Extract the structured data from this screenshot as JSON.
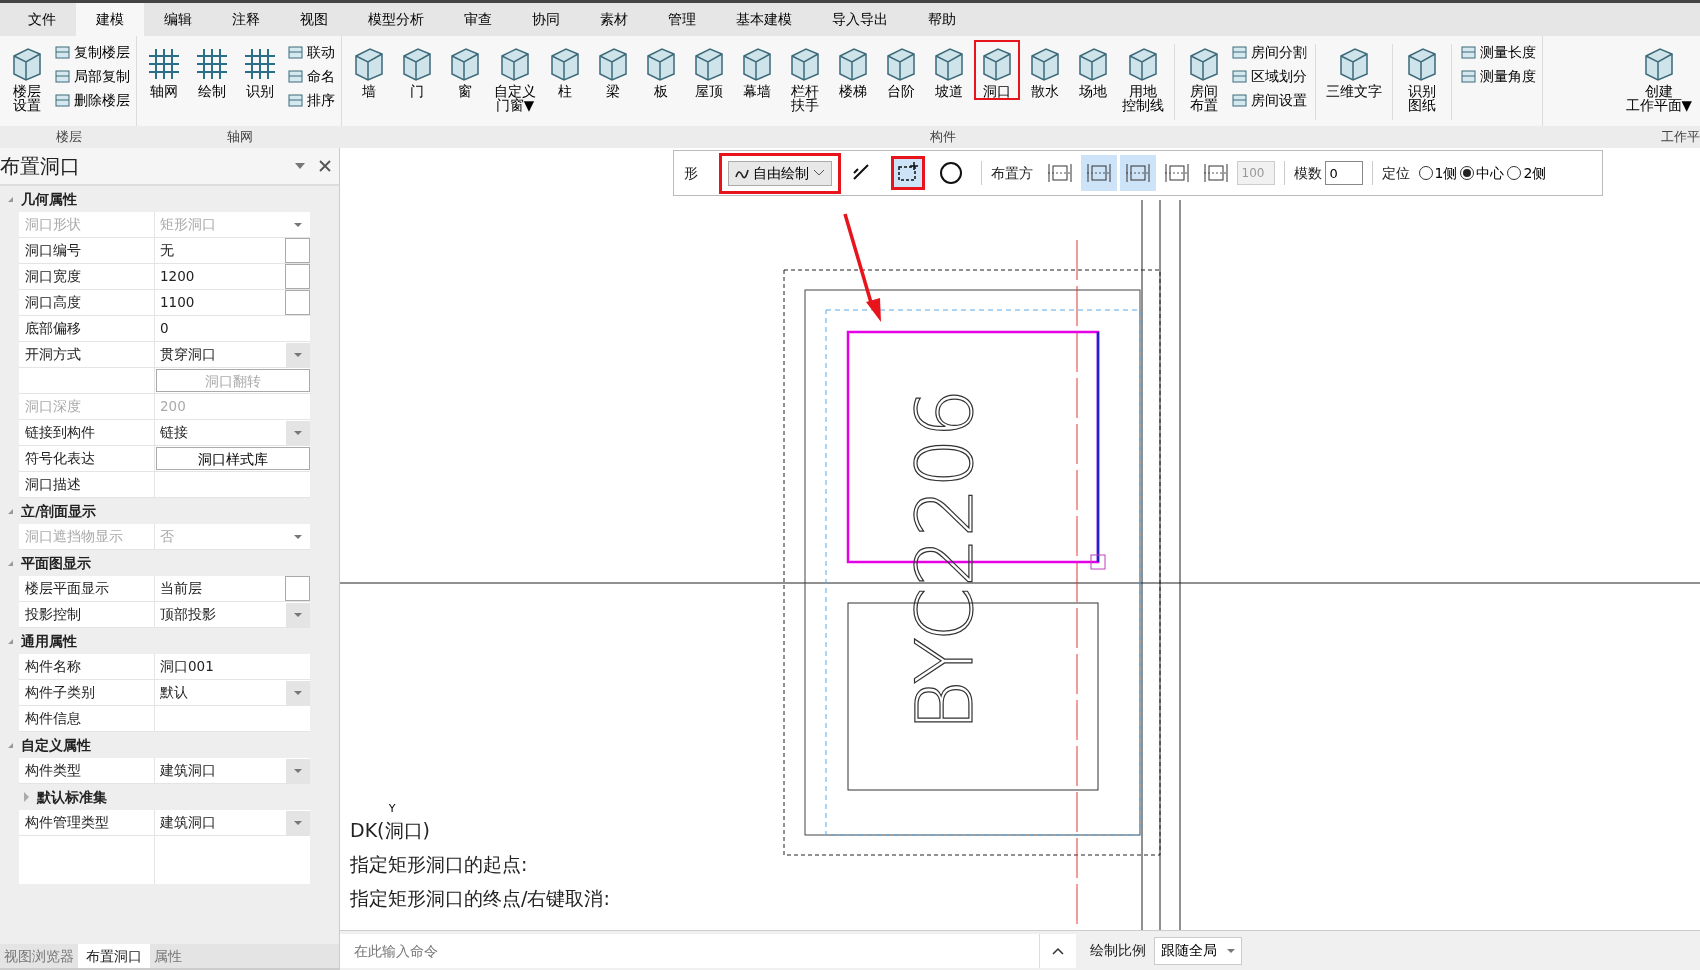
{
  "menu_tabs": [
    {
      "label": "文件",
      "selected": false
    },
    {
      "label": "建模",
      "selected": true
    },
    {
      "label": "编辑",
      "selected": false
    },
    {
      "label": "注释",
      "selected": false
    },
    {
      "label": "视图",
      "selected": false
    },
    {
      "label": "模型分析",
      "selected": false
    },
    {
      "label": "审查",
      "selected": false
    },
    {
      "label": "协同",
      "selected": false
    },
    {
      "label": "素材",
      "selected": false
    },
    {
      "label": "管理",
      "selected": false
    },
    {
      "label": "基本建模",
      "selected": false
    },
    {
      "label": "导入导出",
      "selected": false
    },
    {
      "label": "帮助",
      "selected": false
    }
  ],
  "ribbon": [
    {
      "label": "楼层",
      "items": [
        {
          "kind": "large",
          "lines": [
            "楼层",
            "设置"
          ],
          "highlighted": false
        },
        {
          "kind": "stack",
          "items": [
            "复制楼层",
            "局部复制",
            "删除楼层"
          ]
        }
      ]
    },
    {
      "label": "轴网",
      "items": [
        {
          "kind": "large",
          "label": "轴网",
          "highlighted": false
        },
        {
          "kind": "large",
          "label": "绘制",
          "highlighted": false
        },
        {
          "kind": "large",
          "label": "识别",
          "highlighted": false
        },
        {
          "kind": "stack",
          "items": [
            "联动",
            "命名",
            "排序"
          ]
        }
      ]
    },
    {
      "label": "构件",
      "items": [
        {
          "kind": "large",
          "label": "墙",
          "highlighted": false
        },
        {
          "kind": "large",
          "label": "门",
          "highlighted": false
        },
        {
          "kind": "large",
          "label": "窗",
          "highlighted": false
        },
        {
          "kind": "large",
          "lines": [
            "自定义",
            "门窗▼"
          ],
          "highlighted": false
        },
        {
          "kind": "large",
          "label": "柱",
          "highlighted": false
        },
        {
          "kind": "large",
          "label": "梁",
          "highlighted": false
        },
        {
          "kind": "large",
          "label": "板",
          "highlighted": false
        },
        {
          "kind": "large",
          "label": "屋顶",
          "highlighted": false
        },
        {
          "kind": "large",
          "label": "幕墙",
          "highlighted": false
        },
        {
          "kind": "large",
          "lines": [
            "栏杆",
            "扶手"
          ],
          "highlighted": false
        },
        {
          "kind": "large",
          "label": "楼梯",
          "highlighted": false
        },
        {
          "kind": "large",
          "label": "台阶",
          "highlighted": false
        },
        {
          "kind": "large",
          "label": "坡道",
          "highlighted": false
        },
        {
          "kind": "large",
          "label": "洞口",
          "highlighted": true
        },
        {
          "kind": "large",
          "label": "散水",
          "highlighted": false
        },
        {
          "kind": "large",
          "label": "场地",
          "highlighted": false
        },
        {
          "kind": "large",
          "lines": [
            "用地",
            "控制线"
          ],
          "highlighted": false
        },
        {
          "kind": "separator"
        },
        {
          "kind": "large",
          "lines": [
            "房间",
            "布置"
          ],
          "highlighted": false
        },
        {
          "kind": "stack",
          "items": [
            "房间分割",
            "区域划分",
            "房间设置"
          ]
        },
        {
          "kind": "separator"
        },
        {
          "kind": "large",
          "label": "三维文字",
          "highlighted": false
        },
        {
          "kind": "separator"
        },
        {
          "kind": "large",
          "lines": [
            "识别",
            "图纸"
          ],
          "highlighted": false
        },
        {
          "kind": "separator"
        },
        {
          "kind": "stack",
          "items": [
            "测量长度",
            "测量角度"
          ]
        }
      ]
    },
    {
      "label": "工作平",
      "items": [
        {
          "kind": "large",
          "lines": [
            "创建",
            "工作平面▼"
          ],
          "highlighted": false
        }
      ]
    }
  ],
  "panel": {
    "title": "布置洞口",
    "sections": [
      {
        "label": "几何属性",
        "expanded": true,
        "rows": [
          {
            "kind": "dropdown",
            "label": "洞口形状",
            "value": "矩形洞口",
            "disabled": true
          },
          {
            "kind": "box",
            "label": "洞口编号",
            "value": "无",
            "disabled": false
          },
          {
            "kind": "box",
            "label": "洞口宽度",
            "value": "1200",
            "disabled": false
          },
          {
            "kind": "box",
            "label": "洞口高度",
            "value": "1100",
            "disabled": false
          },
          {
            "kind": "text",
            "label": "底部偏移",
            "value": "0",
            "disabled": false
          },
          {
            "kind": "dropdown",
            "label": "开洞方式",
            "value": "贯穿洞口",
            "disabled": false
          },
          {
            "kind": "button",
            "value": "洞口翻转",
            "disabled": true
          },
          {
            "kind": "text",
            "label": "洞口深度",
            "value": "200",
            "disabled": true
          },
          {
            "kind": "dropdown",
            "label": "链接到构件",
            "value": "链接",
            "disabled": false
          },
          {
            "kind": "button",
            "label": "符号化表达",
            "value": "洞口样式库",
            "disabled": false
          },
          {
            "kind": "text",
            "label": "洞口描述",
            "disabled": false
          }
        ]
      },
      {
        "label": "立/剖面显示",
        "expanded": true,
        "rows": [
          {
            "kind": "dropdown",
            "label": "洞口遮挡物显示",
            "value": "否",
            "disabled": true
          }
        ]
      },
      {
        "label": "平面图显示",
        "expanded": true,
        "rows": [
          {
            "kind": "box",
            "label": "楼层平面显示",
            "value": "当前层",
            "disabled": false
          },
          {
            "kind": "dropdown",
            "label": "投影控制",
            "value": "顶部投影",
            "disabled": false
          }
        ]
      },
      {
        "label": "通用属性",
        "expanded": true,
        "rows": [
          {
            "kind": "text",
            "label": "构件名称",
            "value": "洞口001",
            "disabled": false
          },
          {
            "kind": "dropdown",
            "label": "构件子类别",
            "value": "默认",
            "disabled": false
          },
          {
            "kind": "text",
            "label": "构件信息",
            "disabled": false
          }
        ]
      },
      {
        "label": "自定义属性",
        "expanded": true,
        "rows": [
          {
            "kind": "dropdown",
            "label": "构件类型",
            "value": "建筑洞口",
            "disabled": false
          },
          {
            "kind": "subgroup",
            "label": "默认标准集",
            "expanded": false
          },
          {
            "kind": "dropdown",
            "label": "构件管理类型",
            "value": "建筑洞口",
            "disabled": false
          }
        ]
      }
    ]
  },
  "bottom_tabs": [
    {
      "label": "视图浏览器",
      "selected": false
    },
    {
      "label": "布置洞口",
      "selected": true
    },
    {
      "label": "属性",
      "selected": false
    }
  ],
  "toolbar": {
    "shape_label": "形",
    "mode_dropdown": {
      "value": "自由绘制",
      "highlighted": true
    },
    "tools": [
      {
        "kind": "pen",
        "selected": false,
        "highlighted": false
      },
      {
        "kind": "rect",
        "selected": true,
        "highlighted": true
      },
      {
        "kind": "circle",
        "selected": false,
        "highlighted": false
      }
    ],
    "place_label": "布置方",
    "placements": [
      {
        "selected": false
      },
      {
        "selected": true
      },
      {
        "selected": true
      },
      {
        "selected": false
      },
      {
        "selected": false
      }
    ],
    "offset": {
      "value": "100",
      "disabled": true
    },
    "modulus": {
      "label": "模数",
      "value": "0"
    },
    "position": {
      "label": "定位",
      "options": [
        {
          "label": "1侧",
          "selected": false
        },
        {
          "label": "中心",
          "selected": true
        },
        {
          "label": "2侧",
          "selected": false
        }
      ]
    }
  },
  "drawing": {
    "label": "BYC2206",
    "axis_label": "Y"
  },
  "command_history": [
    "DK(洞口)",
    "指定矩形洞口的起点:",
    "指定矩形洞口的终点/右键取消:"
  ],
  "command_bar": {
    "placeholder": "在此输入命令",
    "scale_label": "绘制比例",
    "scale_value": "跟随全局"
  }
}
